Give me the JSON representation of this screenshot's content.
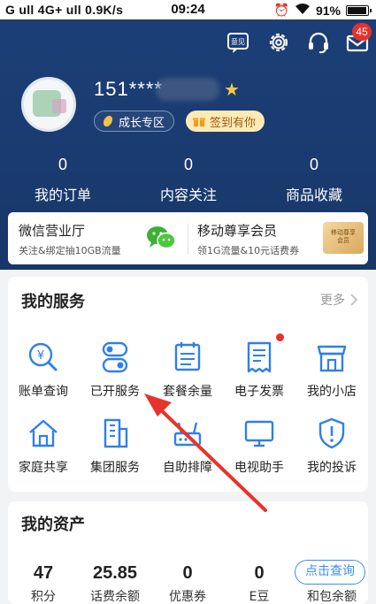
{
  "status_bar": {
    "left": "G ull 4G+ ull 0.9K/s",
    "time": "09:24",
    "battery": "91%"
  },
  "header": {
    "feedback_label": "意见",
    "message_badge": "45"
  },
  "profile": {
    "phone": "151****",
    "growth_zone": "成长专区",
    "sign_in": "签到有你"
  },
  "stats": [
    {
      "value": "0",
      "label": "我的订单"
    },
    {
      "value": "0",
      "label": "内容关注"
    },
    {
      "value": "0",
      "label": "商品收藏"
    }
  ],
  "promo": {
    "wechat": {
      "title": "微信营业厅",
      "subtitle": "关注&绑定抽10GB流量"
    },
    "vip": {
      "title": "移动尊享会员",
      "subtitle": "领1G流量&10元话费券",
      "card_label": "移动尊享\n会员"
    }
  },
  "services": {
    "title": "我的服务",
    "more": "更多",
    "items": [
      {
        "label": "账单查询",
        "icon": "bill-search-icon"
      },
      {
        "label": "已开服务",
        "icon": "toggle-service-icon"
      },
      {
        "label": "套餐余量",
        "icon": "calendar-icon"
      },
      {
        "label": "电子发票",
        "icon": "invoice-icon"
      },
      {
        "label": "我的小店",
        "icon": "shop-icon"
      },
      {
        "label": "家庭共享",
        "icon": "home-icon"
      },
      {
        "label": "集团服务",
        "icon": "building-icon"
      },
      {
        "label": "自助排障",
        "icon": "router-icon"
      },
      {
        "label": "电视助手",
        "icon": "tv-icon"
      },
      {
        "label": "我的投诉",
        "icon": "shield-alert-icon"
      }
    ]
  },
  "assets": {
    "title": "我的资产",
    "items": [
      {
        "value": "47",
        "label": "积分"
      },
      {
        "value": "25.85",
        "label": "话费余额"
      },
      {
        "value": "0",
        "label": "优惠券"
      },
      {
        "value": "0",
        "label": "E豆"
      },
      {
        "value": "",
        "label": "和包余额"
      }
    ],
    "query_button": "点击查询"
  },
  "colors": {
    "header_bg": "#1c3f78",
    "accent_blue": "#3d8df2",
    "badge_red": "#e7312b",
    "wechat_green": "#3cb034"
  }
}
